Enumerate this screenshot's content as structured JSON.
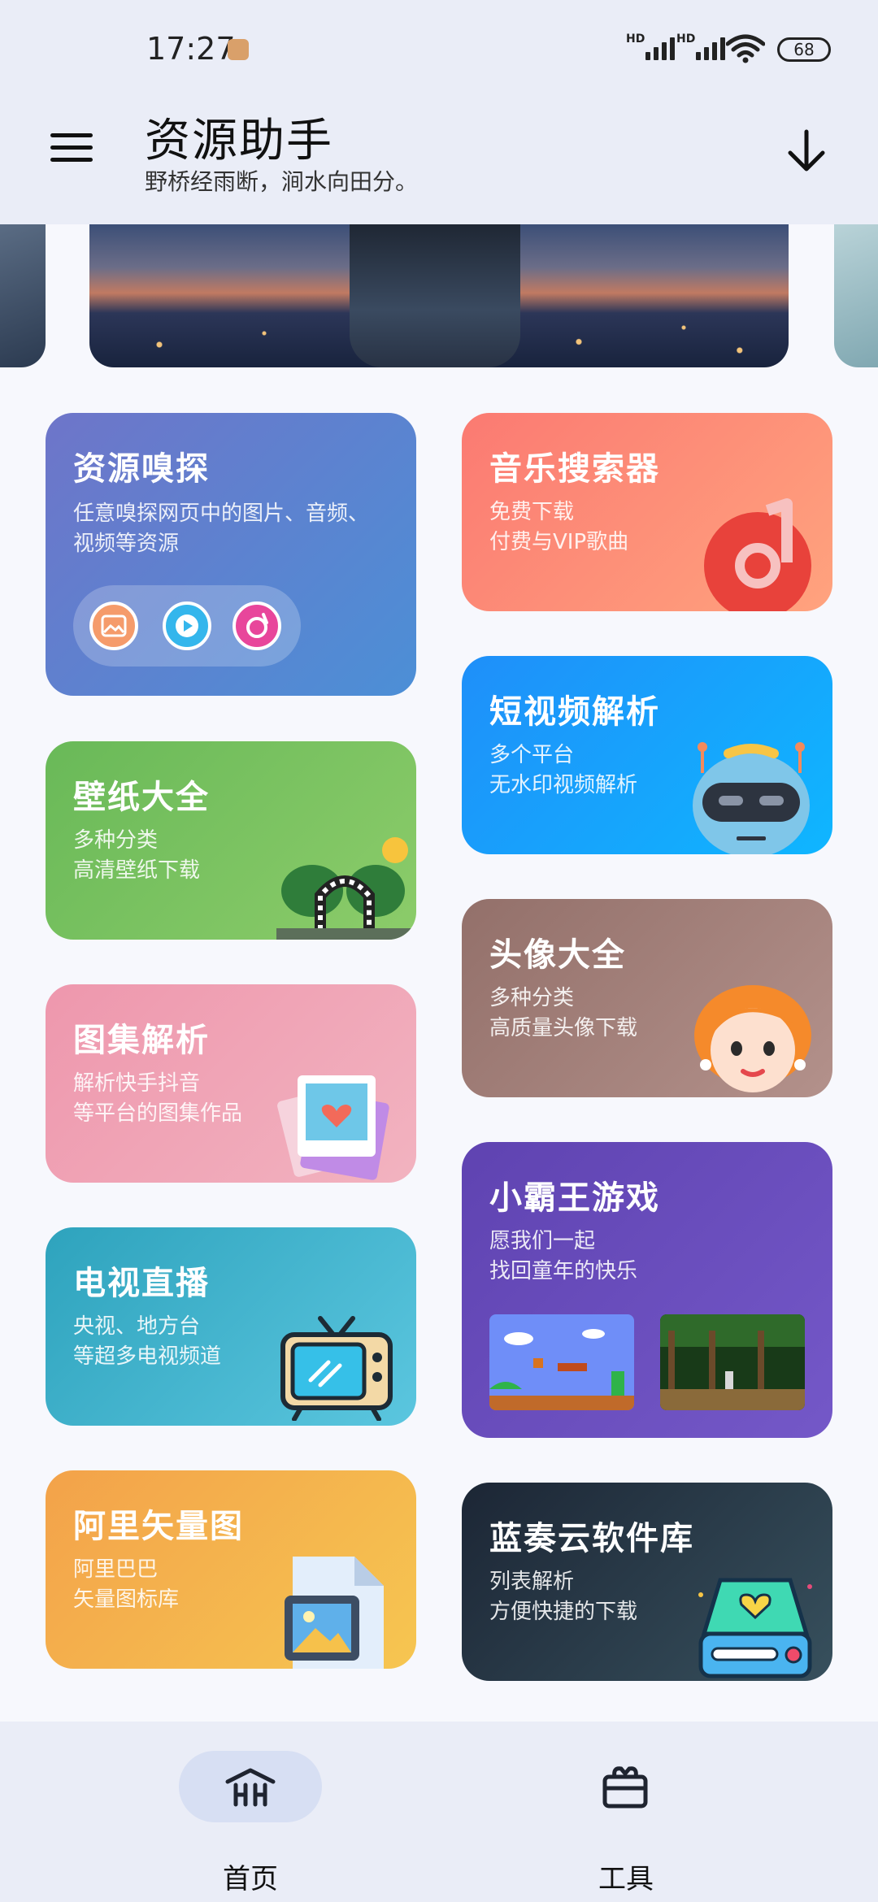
{
  "status_bar": {
    "time": "17:27",
    "signal_1": "HD",
    "signal_2": "HD",
    "battery": "68"
  },
  "header": {
    "title": "资源助手",
    "subtitle": "野桥经雨断，涧水向田分。",
    "menu_icon": "menu-icon",
    "download_icon": "download-icon"
  },
  "cards": {
    "sniffer": {
      "title": "资源嗅探",
      "desc": "任意嗅探网页中的图片、音频、视频等资源",
      "colors": [
        "#6e75c9",
        "#4c8fd6"
      ]
    },
    "music": {
      "title": "音乐搜索器",
      "desc_1": "免费下载",
      "desc_2": "付费与VIP歌曲",
      "colors": [
        "#fb7a72",
        "#ffa37e"
      ]
    },
    "short_video": {
      "title": "短视频解析",
      "desc_1": "多个平台",
      "desc_2": "无水印视频解析",
      "colors": [
        "#1f8ff9",
        "#0fb6ff"
      ]
    },
    "wallpaper": {
      "title": "壁纸大全",
      "desc_1": "多种分类",
      "desc_2": "高清壁纸下载",
      "colors": [
        "#69b958",
        "#8ccc6a"
      ]
    },
    "avatar": {
      "title": "头像大全",
      "desc_1": "多种分类",
      "desc_2": "高质量头像下载",
      "colors": [
        "#93706a",
        "#b3918b"
      ]
    },
    "gallery": {
      "title": "图集解析",
      "desc_1": "解析快手抖音",
      "desc_2": "等平台的图集作品",
      "colors": [
        "#ee97ad",
        "#f2b3c0"
      ]
    },
    "nes": {
      "title": "小霸王游戏",
      "desc_1": "愿我们一起",
      "desc_2": "找回童年的快乐",
      "colors": [
        "#5f43b1",
        "#7458c8"
      ]
    },
    "tv": {
      "title": "电视直播",
      "desc_1": "央视、地方台",
      "desc_2": "等超多电视频道",
      "colors": [
        "#2ea3bd",
        "#5bc6df"
      ]
    },
    "vector": {
      "title": "阿里矢量图",
      "desc_1": "阿里巴巴",
      "desc_2": "矢量图标库",
      "colors": [
        "#f3a24a",
        "#f6c651"
      ]
    },
    "lanzou": {
      "title": "蓝奏云软件库",
      "desc_1": "列表解析",
      "desc_2": "方便快捷的下载",
      "colors": [
        "#1c2635",
        "#37505d"
      ]
    }
  },
  "bottom_nav": {
    "home_label": "首页",
    "tools_label": "工具",
    "active": "首页"
  }
}
